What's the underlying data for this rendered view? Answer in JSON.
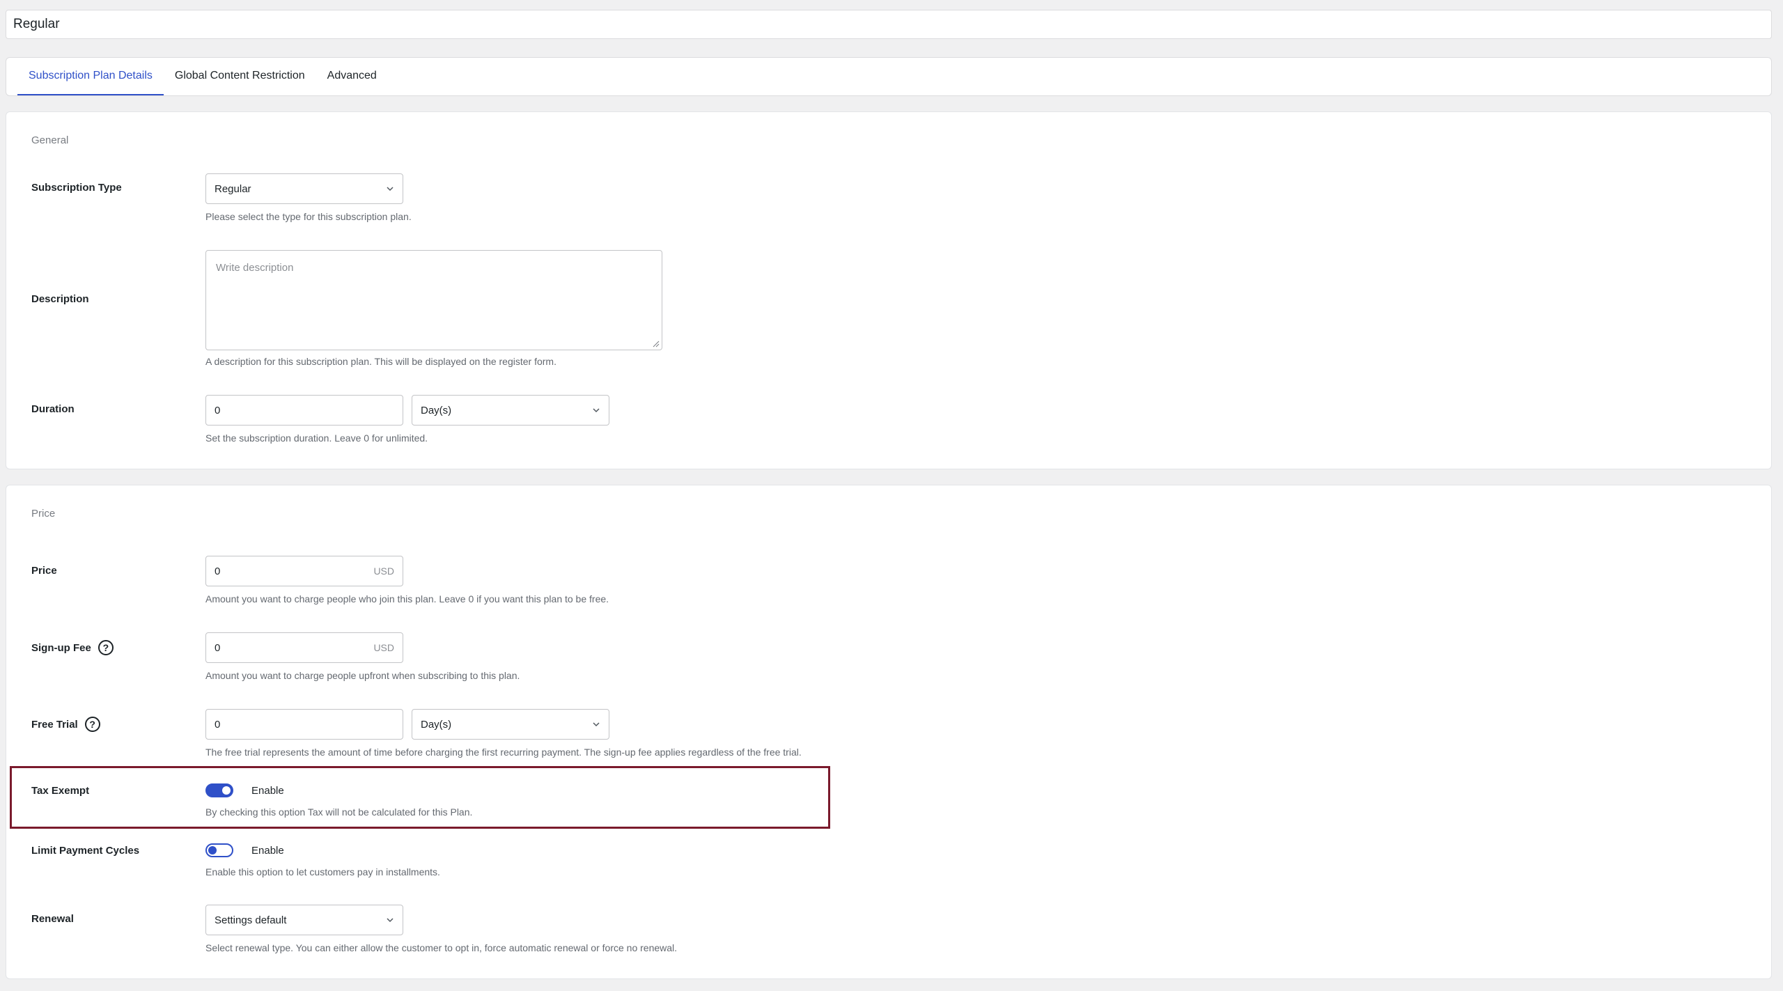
{
  "title_value": "Regular",
  "tabs": [
    {
      "label": "Subscription Plan Details"
    },
    {
      "label": "Global Content Restriction"
    },
    {
      "label": "Advanced"
    }
  ],
  "general": {
    "title": "General",
    "subscription_type": {
      "label": "Subscription Type",
      "value": "Regular",
      "help": "Please select the type for this subscription plan."
    },
    "description": {
      "label": "Description",
      "placeholder": "Write description",
      "help": "A description for this subscription plan. This will be displayed on the register form."
    },
    "duration": {
      "label": "Duration",
      "value": "0",
      "unit": "Day(s)",
      "help": "Set the subscription duration. Leave 0 for unlimited."
    }
  },
  "price_section": {
    "title": "Price",
    "price": {
      "label": "Price",
      "value": "0",
      "currency": "USD",
      "help": "Amount you want to charge people who join this plan. Leave 0 if you want this plan to be free."
    },
    "signup_fee": {
      "label": "Sign-up Fee",
      "value": "0",
      "currency": "USD",
      "help": "Amount you want to charge people upfront when subscribing to this plan."
    },
    "free_trial": {
      "label": "Free Trial",
      "value": "0",
      "unit": "Day(s)",
      "help": "The free trial represents the amount of time before charging the first recurring payment. The sign-up fee applies regardless of the free trial."
    },
    "tax_exempt": {
      "label": "Tax Exempt",
      "toggle_label": "Enable",
      "enabled": true,
      "help": "By checking this option Tax will not be calculated for this Plan."
    },
    "limit_payment_cycles": {
      "label": "Limit Payment Cycles",
      "toggle_label": "Enable",
      "enabled": false,
      "help": "Enable this option to let customers pay in installments."
    },
    "renewal": {
      "label": "Renewal",
      "value": "Settings default",
      "help": "Select renewal type. You can either allow the customer to opt in, force automatic renewal or force no renewal."
    }
  },
  "colors": {
    "accent": "#2f50c8",
    "highlight_border": "#7a1a2c"
  },
  "icons": {
    "help": "question-circle-icon",
    "dropdown": "chevron-down-icon"
  }
}
